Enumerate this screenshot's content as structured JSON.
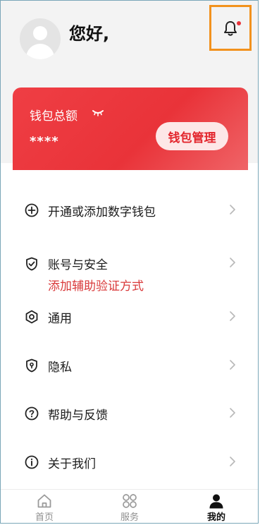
{
  "header": {
    "greeting": "您好,",
    "avatar_icon": "user-avatar-icon",
    "bell_icon": "bell-icon"
  },
  "wallet": {
    "title": "钱包总额",
    "toggle_icon": "eye-closed-icon",
    "masked_amount": "****",
    "manage_label": "钱包管理"
  },
  "menu": [
    {
      "icon": "plus-circle-icon",
      "label": "开通或添加数字钱包",
      "sub": ""
    },
    {
      "icon": "shield-check-icon",
      "label": "账号与安全",
      "sub": "添加辅助验证方式"
    },
    {
      "icon": "settings-hex-icon",
      "label": "通用",
      "sub": ""
    },
    {
      "icon": "privacy-shield-icon",
      "label": "隐私",
      "sub": ""
    },
    {
      "icon": "question-circle-icon",
      "label": "帮助与反馈",
      "sub": ""
    },
    {
      "icon": "info-circle-icon",
      "label": "关于我们",
      "sub": ""
    }
  ],
  "tabbar": {
    "tabs": [
      {
        "label": "首页",
        "icon": "home-icon",
        "active": false
      },
      {
        "label": "服务",
        "icon": "services-grid-icon",
        "active": false
      },
      {
        "label": "我的",
        "icon": "person-icon",
        "active": true
      }
    ]
  },
  "colors": {
    "accent_red": "#e93339",
    "highlight_orange": "#f2921d",
    "sub_text_red": "#d9393a"
  }
}
